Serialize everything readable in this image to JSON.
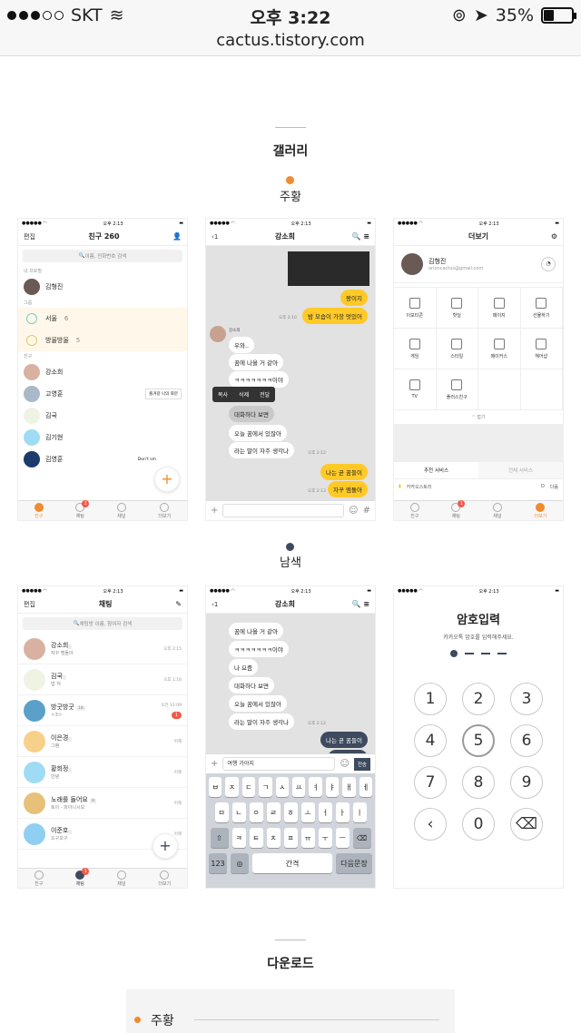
{
  "status_bar": {
    "carrier": "SKT",
    "time": "오후 3:22",
    "battery": "35%"
  },
  "browser": {
    "url": "cactus.tistory.com"
  },
  "gallery": {
    "title": "갤러리"
  },
  "themes": {
    "orange": "주황",
    "navy": "남색",
    "orange_color": "#f08b2e",
    "navy_color": "#3e4a5e"
  },
  "download": {
    "title": "다운로드",
    "item": "주황"
  },
  "mini_status": {
    "time": "오후 2:13"
  },
  "friends_screen": {
    "edit": "편집",
    "title": "친구 260",
    "search": "이름, 전화번호 검색",
    "my_profile_label": "내 프로필",
    "my_name": "김형진",
    "group_label": "그룹",
    "groups": [
      {
        "name": "서울",
        "count": "6"
      },
      {
        "name": "방울방울",
        "count": "5"
      }
    ],
    "friends_label": "친구",
    "friends": [
      {
        "name": "강소희",
        "note": ""
      },
      {
        "name": "고영훈",
        "note": "즐겨갈 나의 화분"
      },
      {
        "name": "김국",
        "note": ""
      },
      {
        "name": "김기현",
        "note": ""
      },
      {
        "name": "김영훈",
        "note": "Don't sm"
      }
    ]
  },
  "tabs": [
    "친구",
    "채팅",
    "채널",
    "더보기"
  ],
  "tab_badge": "1",
  "chat_screen": {
    "back": "1",
    "title": "강소희",
    "sender": "강소희",
    "messages_top": [
      {
        "text": "짱이지",
        "type": "mine"
      },
      {
        "text": "밤 모습이 가장 멋있어",
        "type": "mine",
        "time": "오후 2:10"
      }
    ],
    "messages_other": [
      "우와..",
      "꿈에 나올 거 같아",
      "ㅋㅋㅋㅋㅋㅋㅋ이야",
      "대화하다 보면",
      "오늘 꿈에서 있잖아",
      "라는 말이 자주 생각나"
    ],
    "other_time": "오후 2:12",
    "messages_mine": [
      "나는 곧 꿈들이",
      "자꾸 멤돌아"
    ],
    "mine_time": "오후 2:13",
    "context_menu": [
      "복사",
      "삭제",
      "전달"
    ],
    "plus": "+",
    "hash": "#"
  },
  "more_screen": {
    "title": "더보기",
    "name": "김형진",
    "email": "orioncactus@gmail.com",
    "menu": [
      "이모티콘",
      "핫딜",
      "페이지",
      "선물하기",
      "게임",
      "스타일",
      "메이커스",
      "헤어샵",
      "TV",
      "플러스친구"
    ],
    "collapse": "접기",
    "rec": "추천 서비스",
    "all": "전체 서비스",
    "service1": "카카오스토리",
    "service2": "다음"
  },
  "chat_list_screen": {
    "edit": "편집",
    "title": "채팅",
    "search": "채팅방 이름, 참여자 검색",
    "chats": [
      {
        "name": "강소희",
        "msg": "자꾸 멤돌아",
        "time": "오후 2:15",
        "count": "",
        "badge": ""
      },
      {
        "name": "김국",
        "msg": "밥 쳐",
        "time": "오후 1:16",
        "count": "",
        "badge": ""
      },
      {
        "name": "방굿방굿",
        "msg": "ㅇ3ㅇ",
        "time": "오전 11:09",
        "count": "18",
        "badge": "1"
      },
      {
        "name": "이은경",
        "msg": "그랭",
        "time": "어제",
        "count": "",
        "badge": ""
      },
      {
        "name": "황희정",
        "msg": "안녕",
        "time": "어제",
        "count": "",
        "badge": ""
      },
      {
        "name": "노래를 들어요",
        "msg": "토이 - 피아니시모",
        "time": "어제",
        "count": "8",
        "badge": ""
      },
      {
        "name": "이준호",
        "msg": "오구오구",
        "time": "어제",
        "count": "",
        "badge": ""
      }
    ]
  },
  "navy_chat_screen": {
    "back": "1",
    "title": "강소희",
    "messages_other": [
      "꿈에 나올 거 같아",
      "ㅋㅋㅋㅋㅋㅋㅋ이야",
      "나 요즘",
      "대화하다 보면",
      "오늘 꿈에서 있잖아",
      "라는 말이 자주 생각나"
    ],
    "messages_mine": [
      "나는 곧 꿈들이",
      "자꾸 멤돌아"
    ],
    "input": "여행 가야지",
    "send": "전송",
    "kb_row1": [
      "ㅂ",
      "ㅈ",
      "ㄷ",
      "ㄱ",
      "ㅅ",
      "ㅛ",
      "ㅕ",
      "ㅑ",
      "ㅐ",
      "ㅔ"
    ],
    "kb_row2": [
      "ㅁ",
      "ㄴ",
      "ㅇ",
      "ㄹ",
      "ㅎ",
      "ㅗ",
      "ㅓ",
      "ㅏ",
      "ㅣ"
    ],
    "kb_row3": [
      "ㅋ",
      "ㅌ",
      "ㅊ",
      "ㅍ",
      "ㅠ",
      "ㅜ",
      "ㅡ"
    ],
    "kb_123": "123",
    "kb_space": "간격",
    "kb_next": "다음문장"
  },
  "passcode_screen": {
    "title": "암호입력",
    "subtitle": "카카오톡 암호를 입력해주세요.",
    "keys": [
      "1",
      "2",
      "3",
      "4",
      "5",
      "6",
      "7",
      "8",
      "9",
      "‹",
      "0",
      "⌫"
    ],
    "selected": "5"
  }
}
